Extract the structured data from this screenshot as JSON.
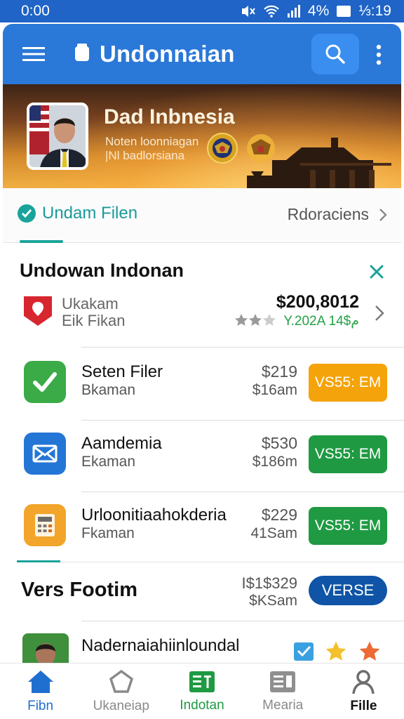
{
  "status_bar": {
    "time": "0:00",
    "battery": "4%",
    "clock_right": "⅓:19"
  },
  "app_bar": {
    "title": "Undonnaian"
  },
  "banner": {
    "title": "Dad Inbnesia",
    "subtitle_line1": "Noten loonniagan",
    "subtitle_line2": "|Nl badlorsiana"
  },
  "tabs": {
    "active_label": "Undam Filen",
    "other_label": "Rdoraciens"
  },
  "section1": {
    "heading": "Undowan Indonan",
    "featured": {
      "line1": "Ukakam",
      "line2": "Eik Fikan",
      "price": "$200,8012",
      "date": "Y.202A 14$م"
    }
  },
  "apps": [
    {
      "name": "Seten Filer",
      "sub": "Bkaman",
      "price": "$219",
      "price2": "$16am",
      "button": "VS55: EM",
      "button_color": "#f5a30a",
      "icon": "checkmark-icon",
      "icon_color": "#3aab47"
    },
    {
      "name": "Aamdemia",
      "sub": "Ekaman",
      "price": "$530",
      "price2": "$186m",
      "button": "VS55: EM",
      "button_color": "#1f9a43",
      "icon": "mail-icon",
      "icon_color": "#2476d6"
    },
    {
      "name": "Urloonitiaahokderia",
      "sub": "Fkaman",
      "price": "$229",
      "price2": "41Sam",
      "button": "VS55: EM",
      "button_color": "#1f9a43",
      "icon": "calculator-icon",
      "icon_color": "#f2a52a"
    }
  ],
  "section2": {
    "heading": "Vers Footim",
    "price1": "I$1$329",
    "price2": "$KSam",
    "button": "VERSE",
    "last_item": "Nadernaiahiinloundal"
  },
  "bottom_nav": [
    {
      "label": "Fibn",
      "icon": "home-icon",
      "color": "#1f6fd1"
    },
    {
      "label": "Ukaneiap",
      "icon": "pentagon-icon",
      "color": "#8a8a8a"
    },
    {
      "label": "Indotan",
      "icon": "grid-icon",
      "color": "#1f9a43"
    },
    {
      "label": "Mearia",
      "icon": "list-icon",
      "color": "#8a8a8a"
    },
    {
      "label": "Fille",
      "icon": "person-icon",
      "color": "#111111"
    }
  ]
}
